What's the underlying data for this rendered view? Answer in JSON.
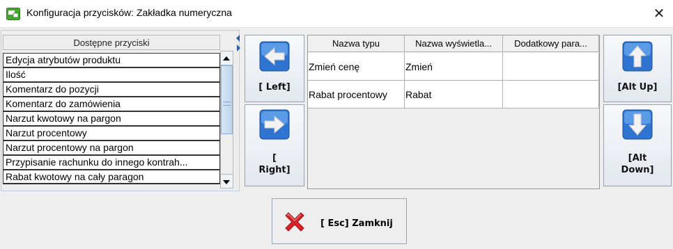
{
  "window": {
    "title": "Konfiguracja przycisków: Zakładka numeryczna",
    "close_glyph": "✕"
  },
  "available_buttons": {
    "header": "Dostępne przyciski",
    "items": [
      "Edycja atrybutów produktu",
      "Ilość",
      "Komentarz do pozycji",
      "Komentarz do zamówienia",
      "Narzut kwotowy na pargon",
      "Narzut procentowy",
      "Narzut procentowy na pargon",
      "Przypisanie rachunku do innego kontrah...",
      "Rabat kwotowy na cały paragon"
    ]
  },
  "move_buttons": {
    "left_label": "[ Left]",
    "right_label_line1": "[",
    "right_label_line2": "Right]",
    "alt_up_label": "[Alt Up]",
    "alt_down_label_line1": "[Alt",
    "alt_down_label_line2": "Down]"
  },
  "assigned_table": {
    "columns": [
      "Nazwa typu",
      "Nazwa wyświetla...",
      "Dodatkowy para..."
    ],
    "rows": [
      [
        "Zmień cenę",
        "Zmień",
        ""
      ],
      [
        "Rabat procentowy",
        "Rabat",
        ""
      ]
    ]
  },
  "footer": {
    "close_label": "[ Esc] Zamknij"
  },
  "colors": {
    "icon_blue": "#2f74d0",
    "icon_red": "#d9232b",
    "app_icon_green": "#46a832"
  }
}
